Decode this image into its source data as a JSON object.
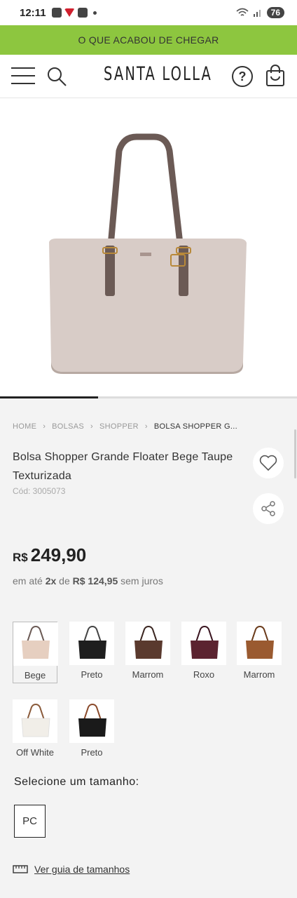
{
  "status_bar": {
    "time": "12:11",
    "battery": "76"
  },
  "banner": {
    "text": "O QUE ACABOU DE CHEGAR"
  },
  "header": {
    "logo": "SANTA LOLLA",
    "help_symbol": "?"
  },
  "breadcrumb": {
    "items": [
      "HOME",
      "BOLSAS",
      "SHOPPER",
      "BOLSA SHOPPER G..."
    ]
  },
  "product": {
    "title": "Bolsa Shopper Grande Floater Bege Taupe Texturizada",
    "sku": "Cód: 3005073",
    "currency": "R$",
    "price": "249,90",
    "installments": {
      "prefix": "em até",
      "count": "2x",
      "of": "de",
      "amount": "R$ 124,95",
      "suffix": "sem juros"
    }
  },
  "colors": [
    {
      "label": "Bege",
      "color": "#e6cfc0",
      "selected": true
    },
    {
      "label": "Preto",
      "color": "#1e1e1e",
      "selected": false
    },
    {
      "label": "Marrom",
      "color": "#5a3a2e",
      "selected": false
    },
    {
      "label": "Roxo",
      "color": "#5b2330",
      "selected": false
    },
    {
      "label": "Marrom",
      "color": "#9a5a30",
      "selected": false
    },
    {
      "label": "Off White",
      "color": "#f1eee8",
      "selected": false
    },
    {
      "label": "Preto",
      "color": "#1a1a1a",
      "selected": false
    }
  ],
  "size": {
    "heading": "Selecione um tamanho:",
    "options": [
      "PC"
    ],
    "guide_link": "Ver guia de tamanhos"
  },
  "theme": {
    "banner_green": "#8dc63f",
    "bag_color": "#d8ccc7",
    "strap_color": "#6b5a55"
  },
  "gallery": {
    "progress": 0.33
  }
}
